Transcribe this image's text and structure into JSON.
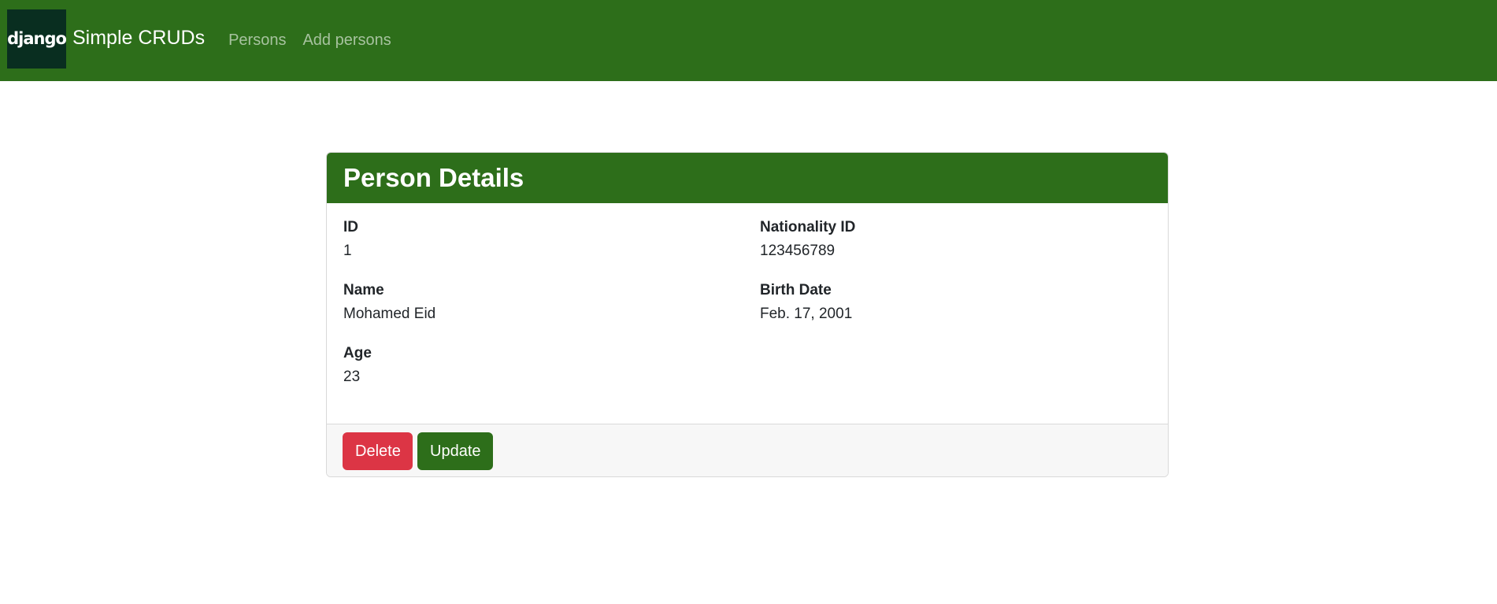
{
  "navbar": {
    "logo_text": "django",
    "brand": "Simple CRUDs",
    "links": [
      {
        "label": "Persons"
      },
      {
        "label": "Add persons"
      }
    ]
  },
  "card": {
    "title": "Person Details",
    "fields": {
      "id": {
        "label": "ID",
        "value": "1"
      },
      "nationality_id": {
        "label": "Nationality ID",
        "value": "123456789"
      },
      "name": {
        "label": "Name",
        "value": "Mohamed Eid"
      },
      "birth_date": {
        "label": "Birth Date",
        "value": "Feb. 17, 2001"
      },
      "age": {
        "label": "Age",
        "value": "23"
      }
    },
    "actions": {
      "delete_label": "Delete",
      "update_label": "Update"
    }
  },
  "colors": {
    "primary": "#2d6e1a",
    "danger": "#dc3545",
    "django_logo_bg": "#092e20"
  }
}
